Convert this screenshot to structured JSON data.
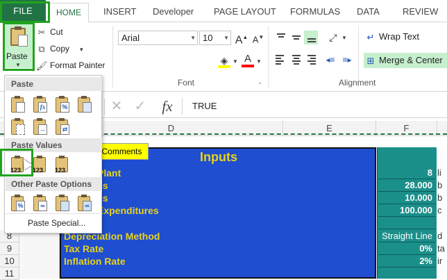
{
  "tabs": [
    {
      "label": "FILE"
    },
    {
      "label": "HOME"
    },
    {
      "label": "INSERT"
    },
    {
      "label": "Developer"
    },
    {
      "label": "PAGE LAYOUT"
    },
    {
      "label": "FORMULAS"
    },
    {
      "label": "DATA"
    },
    {
      "label": "REVIEW"
    }
  ],
  "clipboard": {
    "paste_label": "Paste",
    "cut_label": "Cut",
    "copy_label": "Copy",
    "format_painter_label": "Format Painter"
  },
  "font": {
    "name": "Arial",
    "size": "10",
    "group_label": "Font",
    "grow": "A",
    "shrink": "A",
    "font_color_letter": "A"
  },
  "alignment": {
    "wrap_text_label": "Wrap Text",
    "merge_center_label": "Merge & Center",
    "group_label": "Alignment"
  },
  "formula_bar": {
    "fx": "fx",
    "value": "TRUE"
  },
  "columns": {
    "d": "D",
    "e": "E",
    "f": "F"
  },
  "paste_menu": {
    "section_paste": "Paste",
    "section_values": "Paste Values",
    "section_other": "Other Paste Options",
    "paste_special": "Paste Special...",
    "values_icon_text": "123",
    "fx_text": "fx",
    "pct_text": "%"
  },
  "sheet": {
    "comments_button": "Comments",
    "title": "Inputs",
    "rows": [
      {
        "label": "Plant",
        "value": "8",
        "g": "li"
      },
      {
        "label": "es",
        "value": "28.000",
        "g": "b"
      },
      {
        "label": "es",
        "value": "10.000",
        "g": "b"
      },
      {
        "label": "Expenditures",
        "value": "100.000",
        "g": "c"
      },
      {
        "label": "",
        "value": "",
        "g": ""
      },
      {
        "row": "8",
        "label": "Depreciation Method",
        "value": "Straight Line",
        "g": "d"
      },
      {
        "row": "9",
        "label": "Tax Rate",
        "value": "0%",
        "g": "ta"
      },
      {
        "row": "10",
        "label": "Inflation Rate",
        "value": "2%",
        "g": "ir"
      },
      {
        "row": "11",
        "label": "",
        "value": "",
        "g": ""
      }
    ]
  },
  "colors": {
    "excel_green": "#217346",
    "highlight_green": "#22a31e",
    "input_blue": "#1f4ed1",
    "label_yellow": "#e8d31a",
    "value_teal": "#1b8f8a",
    "comments_yellow": "#ffff00"
  }
}
